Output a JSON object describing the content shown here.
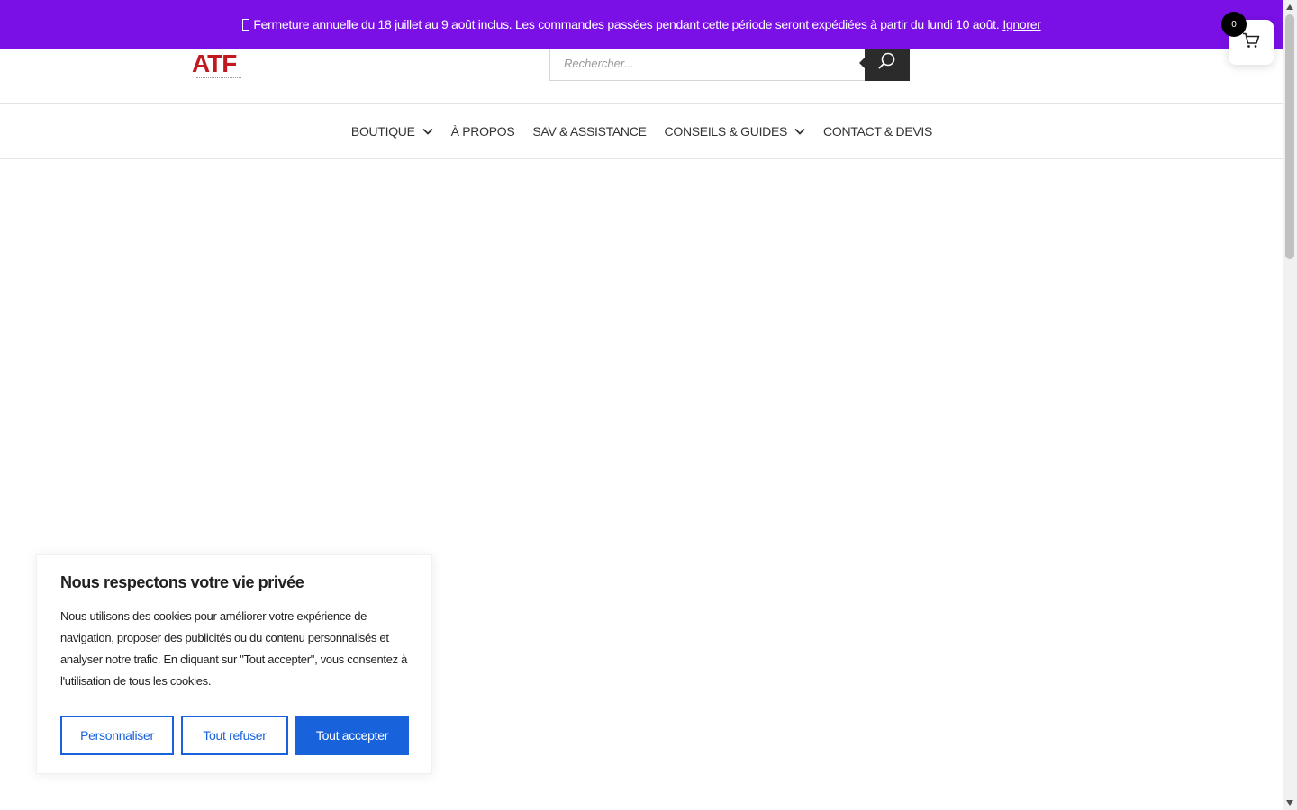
{
  "notice": {
    "message": "Fermeture annuelle du 18 juillet au 9 août inclus. Les commandes passées pendant cette période seront expédiées à partir du lundi 10 août.",
    "dismiss_label": "Ignorer"
  },
  "header": {
    "logo_text": "ATF",
    "search_placeholder": "Rechercher..."
  },
  "nav": {
    "items": [
      {
        "label": "BOUTIQUE",
        "has_dropdown": true
      },
      {
        "label": "À PROPOS",
        "has_dropdown": false
      },
      {
        "label": "SAV & ASSISTANCE",
        "has_dropdown": false
      },
      {
        "label": "CONSEILS & GUIDES",
        "has_dropdown": true
      },
      {
        "label": "CONTACT & DEVIS",
        "has_dropdown": false
      }
    ]
  },
  "cart": {
    "count": "0",
    "icon": "cart-icon"
  },
  "cookie_banner": {
    "title": "Nous respectons votre vie privée",
    "body": "Nous utilisons des cookies pour améliorer votre expérience de navigation, proposer des publicités ou du contenu personnalisés et analyser notre trafic. En cliquant sur \"Tout accepter\", vous consentez à l'utilisation de tous les cookies.",
    "customize_label": "Personnaliser",
    "reject_label": "Tout refuser",
    "accept_label": "Tout accepter"
  },
  "colors": {
    "notice_bg": "#7a10e6",
    "logo_red": "#c0191f",
    "accent_blue": "#1863dc",
    "search_button": "#2b2b2b"
  }
}
